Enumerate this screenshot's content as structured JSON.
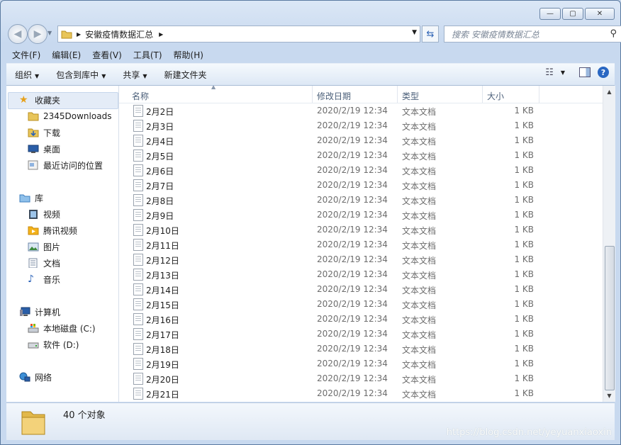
{
  "window": {
    "caption_buttons": [
      "—",
      "▢",
      "✕"
    ]
  },
  "nav": {
    "back_icon": "back-arrow-icon",
    "forward_icon": "forward-arrow-icon",
    "address_path": "安徽疫情数据汇总",
    "search_placeholder": "搜索 安徽疫情数据汇总"
  },
  "menu": [
    "文件(F)",
    "编辑(E)",
    "查看(V)",
    "工具(T)",
    "帮助(H)"
  ],
  "toolbar": [
    "组织",
    "包含到库中",
    "共享",
    "新建文件夹"
  ],
  "sidebar": {
    "favorites": {
      "label": "收藏夹",
      "items": [
        "2345Downloads",
        "下载",
        "桌面",
        "最近访问的位置"
      ]
    },
    "libraries": {
      "label": "库",
      "items": [
        "视频",
        "腾讯视频",
        "图片",
        "文档",
        "音乐"
      ]
    },
    "computer": {
      "label": "计算机",
      "items": [
        "本地磁盘 (C:)",
        "软件 (D:)"
      ]
    },
    "network": {
      "label": "网络"
    }
  },
  "columns": [
    "名称",
    "修改日期",
    "类型",
    "大小"
  ],
  "files": [
    {
      "name": "2月2日",
      "date": "2020/2/19 12:34",
      "type": "文本文档",
      "size": "1 KB"
    },
    {
      "name": "2月3日",
      "date": "2020/2/19 12:34",
      "type": "文本文档",
      "size": "1 KB"
    },
    {
      "name": "2月4日",
      "date": "2020/2/19 12:34",
      "type": "文本文档",
      "size": "1 KB"
    },
    {
      "name": "2月5日",
      "date": "2020/2/19 12:34",
      "type": "文本文档",
      "size": "1 KB"
    },
    {
      "name": "2月6日",
      "date": "2020/2/19 12:34",
      "type": "文本文档",
      "size": "1 KB"
    },
    {
      "name": "2月7日",
      "date": "2020/2/19 12:34",
      "type": "文本文档",
      "size": "1 KB"
    },
    {
      "name": "2月8日",
      "date": "2020/2/19 12:34",
      "type": "文本文档",
      "size": "1 KB"
    },
    {
      "name": "2月9日",
      "date": "2020/2/19 12:34",
      "type": "文本文档",
      "size": "1 KB"
    },
    {
      "name": "2月10日",
      "date": "2020/2/19 12:34",
      "type": "文本文档",
      "size": "1 KB"
    },
    {
      "name": "2月11日",
      "date": "2020/2/19 12:34",
      "type": "文本文档",
      "size": "1 KB"
    },
    {
      "name": "2月12日",
      "date": "2020/2/19 12:34",
      "type": "文本文档",
      "size": "1 KB"
    },
    {
      "name": "2月13日",
      "date": "2020/2/19 12:34",
      "type": "文本文档",
      "size": "1 KB"
    },
    {
      "name": "2月14日",
      "date": "2020/2/19 12:34",
      "type": "文本文档",
      "size": "1 KB"
    },
    {
      "name": "2月15日",
      "date": "2020/2/19 12:34",
      "type": "文本文档",
      "size": "1 KB"
    },
    {
      "name": "2月16日",
      "date": "2020/2/19 12:34",
      "type": "文本文档",
      "size": "1 KB"
    },
    {
      "name": "2月17日",
      "date": "2020/2/19 12:34",
      "type": "文本文档",
      "size": "1 KB"
    },
    {
      "name": "2月18日",
      "date": "2020/2/19 12:34",
      "type": "文本文档",
      "size": "1 KB"
    },
    {
      "name": "2月19日",
      "date": "2020/2/19 12:34",
      "type": "文本文档",
      "size": "1 KB"
    },
    {
      "name": "2月20日",
      "date": "2020/2/19 12:34",
      "type": "文本文档",
      "size": "1 KB"
    },
    {
      "name": "2月21日",
      "date": "2020/2/19 12:34",
      "type": "文本文档",
      "size": "1 KB"
    }
  ],
  "status": {
    "count": "40 个对象"
  },
  "watermark": "https://blog.csdn.net/yeyuanxiaoxin"
}
